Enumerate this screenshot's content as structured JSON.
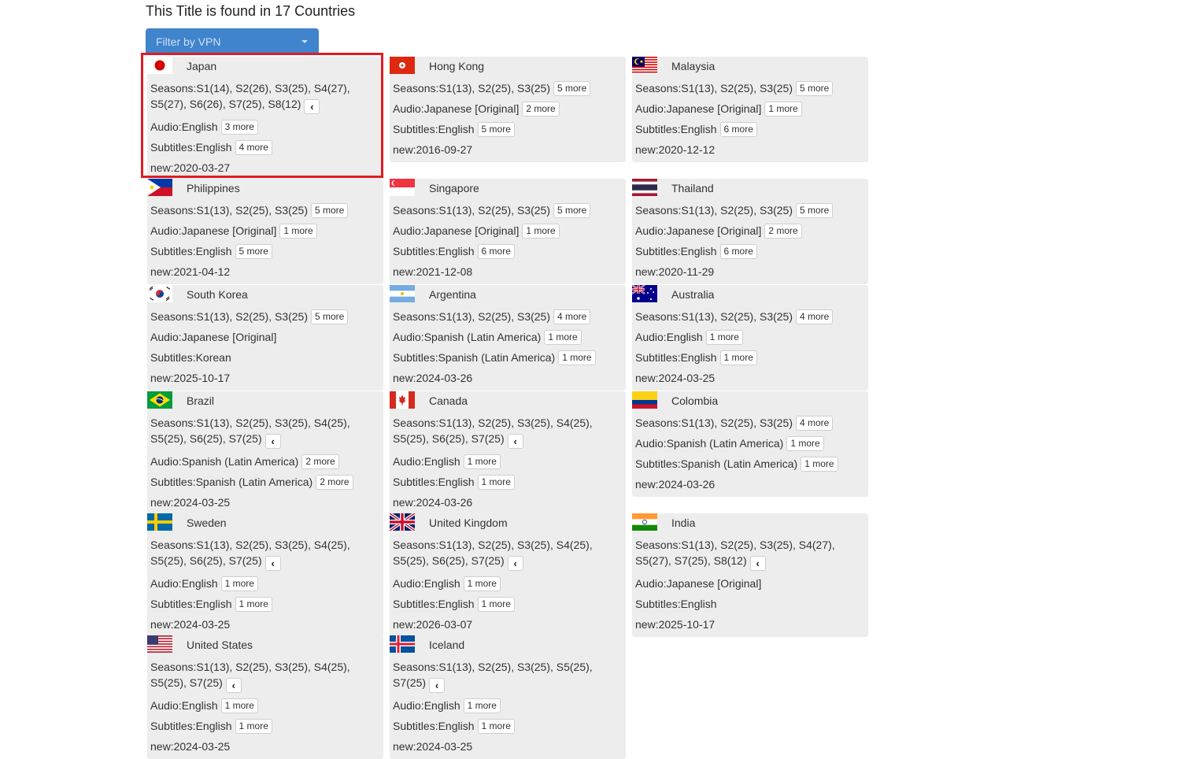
{
  "header": {
    "title": "This Title is found in 17 Countries"
  },
  "filter": {
    "label": "Filter by VPN"
  },
  "labels": {
    "seasons": "Seasons:",
    "audio": "Audio:",
    "subtitles": "Subtitles:",
    "new": "new:"
  },
  "countries": [
    {
      "name": "Japan",
      "flag": "jp",
      "seasons": "S1(14), S2(26), S3(25), S4(27), S5(27), S6(26), S7(25), S8(12)",
      "seasons_expanded": true,
      "audio": "English",
      "audio_more": "3 more",
      "subs": "English",
      "subs_more": "4 more",
      "new": "2020-03-27"
    },
    {
      "name": "Hong Kong",
      "flag": "hk",
      "seasons": "S1(13), S2(25), S3(25)",
      "seasons_more": "5 more",
      "audio": "Japanese [Original]",
      "audio_more": "2 more",
      "subs": "English",
      "subs_more": "5 more",
      "new": "2016-09-27"
    },
    {
      "name": "Malaysia",
      "flag": "my",
      "seasons": "S1(13), S2(25), S3(25)",
      "seasons_more": "5 more",
      "audio": "Japanese [Original]",
      "audio_more": "1 more",
      "subs": "English",
      "subs_more": "6 more",
      "new": "2020-12-12"
    },
    {
      "name": "Philippines",
      "flag": "ph",
      "seasons": "S1(13), S2(25), S3(25)",
      "seasons_more": "5 more",
      "audio": "Japanese [Original]",
      "audio_more": "1 more",
      "subs": "English",
      "subs_more": "5 more",
      "new": "2021-04-12"
    },
    {
      "name": "Singapore",
      "flag": "sg",
      "seasons": "S1(13), S2(25), S3(25)",
      "seasons_more": "5 more",
      "audio": "Japanese [Original]",
      "audio_more": "1 more",
      "subs": "English",
      "subs_more": "6 more",
      "new": "2021-12-08"
    },
    {
      "name": "Thailand",
      "flag": "th",
      "seasons": "S1(13), S2(25), S3(25)",
      "seasons_more": "5 more",
      "audio": "Japanese [Original]",
      "audio_more": "2 more",
      "subs": "English",
      "subs_more": "6 more",
      "new": "2020-11-29"
    },
    {
      "name": "South Korea",
      "flag": "kr",
      "seasons": "S1(13), S2(25), S3(25)",
      "seasons_more": "5 more",
      "audio": "Japanese [Original]",
      "subs": "Korean",
      "new": "2025-10-17"
    },
    {
      "name": "Argentina",
      "flag": "ar",
      "seasons": "S1(13), S2(25), S3(25)",
      "seasons_more": "4 more",
      "audio": "Spanish (Latin America)",
      "audio_more": "1 more",
      "subs": "Spanish (Latin America)",
      "subs_more": "1 more",
      "new": "2024-03-26"
    },
    {
      "name": "Australia",
      "flag": "au",
      "seasons": "S1(13), S2(25), S3(25)",
      "seasons_more": "4 more",
      "audio": "English",
      "audio_more": "1 more",
      "subs": "English",
      "subs_more": "1 more",
      "new": "2024-03-25"
    },
    {
      "name": "Brazil",
      "flag": "br",
      "seasons": "S1(13), S2(25), S3(25), S4(25), S5(25), S6(25), S7(25)",
      "seasons_expanded": true,
      "audio": "Spanish (Latin America)",
      "audio_more": "2 more",
      "subs": "Spanish (Latin America)",
      "subs_more": "2 more",
      "new": "2024-03-25"
    },
    {
      "name": "Canada",
      "flag": "ca",
      "seasons": "S1(13), S2(25), S3(25), S4(25), S5(25), S6(25), S7(25)",
      "seasons_expanded": true,
      "audio": "English",
      "audio_more": "1 more",
      "subs": "English",
      "subs_more": "1 more",
      "new": "2024-03-26"
    },
    {
      "name": "Colombia",
      "flag": "co",
      "seasons": "S1(13), S2(25), S3(25)",
      "seasons_more": "4 more",
      "audio": "Spanish (Latin America)",
      "audio_more": "1 more",
      "subs": "Spanish (Latin America)",
      "subs_more": "1 more",
      "new": "2024-03-26"
    },
    {
      "name": "Sweden",
      "flag": "se",
      "seasons": "S1(13), S2(25), S3(25), S4(25), S5(25), S6(25), S7(25)",
      "seasons_expanded": true,
      "audio": "English",
      "audio_more": "1 more",
      "subs": "English",
      "subs_more": "1 more",
      "new": "2024-03-25"
    },
    {
      "name": "United Kingdom",
      "flag": "gb",
      "seasons": "S1(13), S2(25), S3(25), S4(25), S5(25), S6(25), S7(25)",
      "seasons_expanded": true,
      "audio": "English",
      "audio_more": "1 more",
      "subs": "English",
      "subs_more": "1 more",
      "new": "2026-03-07"
    },
    {
      "name": "India",
      "flag": "in",
      "seasons": "S1(13), S2(25), S3(25), S4(27), S5(27), S7(25), S8(12)",
      "seasons_expanded": true,
      "audio": "Japanese [Original]",
      "subs": "English",
      "new": "2025-10-17"
    },
    {
      "name": "United States",
      "flag": "us",
      "seasons": "S1(13), S2(25), S3(25), S4(25), S5(25), S7(25)",
      "seasons_expanded": true,
      "audio": "English",
      "audio_more": "1 more",
      "subs": "English",
      "subs_more": "1 more",
      "new": "2024-03-25"
    },
    {
      "name": "Iceland",
      "flag": "is",
      "seasons": "S1(13), S2(25), S3(25), S5(25), S7(25)",
      "seasons_expanded": true,
      "audio": "English",
      "audio_more": "1 more",
      "subs": "English",
      "subs_more": "1 more",
      "new": "2024-03-25"
    }
  ]
}
